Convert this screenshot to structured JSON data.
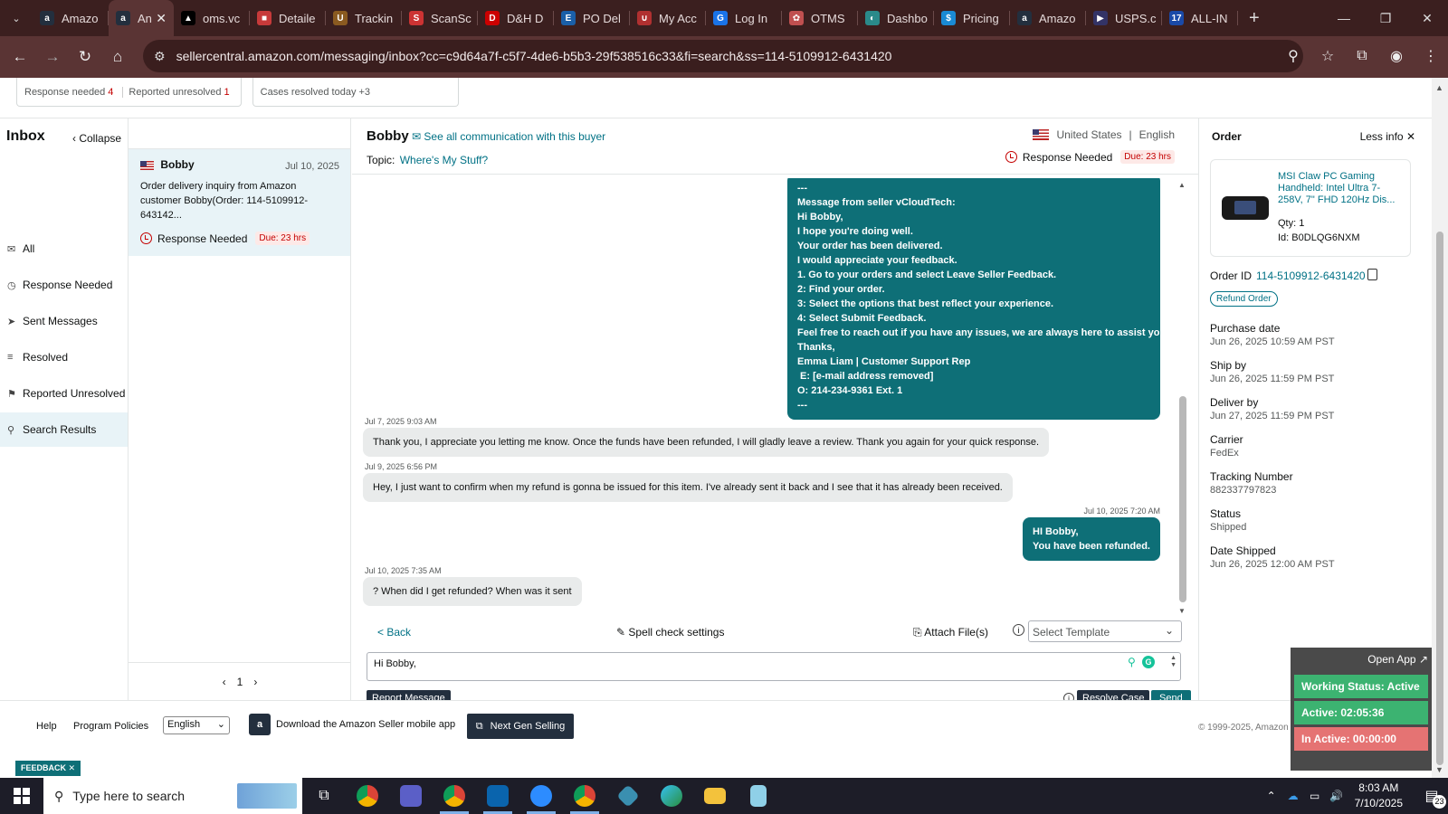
{
  "browser": {
    "tabs": [
      {
        "title": "Amazo",
        "color": "#232f3e",
        "glyph": "a"
      },
      {
        "title": "An",
        "color": "#232f3e",
        "glyph": "a",
        "active": true
      },
      {
        "title": "oms.vc",
        "color": "#000000",
        "glyph": "▲"
      },
      {
        "title": "Detaile",
        "color": "#c73a3a",
        "glyph": "■"
      },
      {
        "title": "Trackin",
        "color": "#8a5a20",
        "glyph": "U"
      },
      {
        "title": "ScanSc",
        "color": "#cc3333",
        "glyph": "S"
      },
      {
        "title": "D&H D",
        "color": "#cc0000",
        "glyph": "D"
      },
      {
        "title": "PO Del",
        "color": "#1a5fa8",
        "glyph": "E"
      },
      {
        "title": "My Acc",
        "color": "#b03030",
        "glyph": "∪"
      },
      {
        "title": "Log In",
        "color": "#1a73e8",
        "glyph": "G"
      },
      {
        "title": "OTMS",
        "color": "#c05050",
        "glyph": "✿"
      },
      {
        "title": "Dashbo",
        "color": "#2a8a8a",
        "glyph": "◐"
      },
      {
        "title": "Pricing",
        "color": "#1a8ad4",
        "glyph": "$"
      },
      {
        "title": "Amazo",
        "color": "#232f3e",
        "glyph": "a"
      },
      {
        "title": "USPS.c",
        "color": "#333366",
        "glyph": "▶"
      },
      {
        "title": "ALL-IN",
        "color": "#1a4aa8",
        "glyph": "17"
      }
    ],
    "url": "sellercentral.amazon.com/messaging/inbox?cc=c9d64a7f-c5f7-4de6-b5b3-29f538516c33&fi=search&ss=114-5109912-6431420"
  },
  "stats": {
    "response_needed_label": "Response needed",
    "response_needed_count": "4",
    "reported_unresolved_label": "Reported unresolved",
    "reported_unresolved_count": "1",
    "cases_resolved_label": "Cases resolved today",
    "cases_resolved_count": "+3"
  },
  "nav": {
    "title": "Inbox",
    "collapse": "Collapse",
    "items": [
      {
        "label": "All",
        "icon": "mail-icon"
      },
      {
        "label": "Response Needed",
        "icon": "clock-icon"
      },
      {
        "label": "Sent Messages",
        "icon": "send-icon"
      },
      {
        "label": "Resolved",
        "icon": "resolved-icon"
      },
      {
        "label": "Reported Unresolved",
        "icon": "reported-icon"
      },
      {
        "label": "Search Results",
        "icon": "search-icon",
        "selected": true
      }
    ]
  },
  "list": {
    "card": {
      "name": "Bobby",
      "date": "Jul 10, 2025",
      "text": "Order delivery inquiry from Amazon customer Bobby(Order: 114-5109912-643142...",
      "status": "Response Needed",
      "due": "Due: 23 hrs"
    },
    "page": "1"
  },
  "conversation": {
    "buyer": "Bobby",
    "see_all": "See all communication with this buyer",
    "topic_label": "Topic:",
    "topic": "Where's My Stuff?",
    "country": "United States",
    "language": "English",
    "response_needed": "Response Needed",
    "due": "Due: 23 hrs",
    "seller_msg": [
      "---",
      "Message from seller vCloudTech:",
      "Hi Bobby,",
      "I hope you're doing well.",
      "Your order has been delivered.",
      "I would appreciate your feedback.",
      "1. Go to your orders and select Leave Seller Feedback.",
      "2: Find your order.",
      "3: Select the options that best reflect your experience.",
      "4: Select Submit Feedback.",
      "Feel free to reach out if you have any issues, we are always here to assist you.",
      "Thanks,",
      "Emma Liam | Customer Support Rep",
      " E: [e-mail address removed]",
      "O: 214-234-9361 Ext. 1",
      "---"
    ],
    "msgs": [
      {
        "ts": "Jul 7, 2025 9:03 AM",
        "text": "Thank you, I appreciate you letting me know. Once the funds have been refunded, I will gladly leave a review. Thank you again for your quick response."
      },
      {
        "ts": "Jul 9, 2025 6:56 PM",
        "text": "Hey, I just want to confirm when my refund is gonna be issued for this item. I've already sent it back and I see that it has already been received."
      }
    ],
    "reply_ts": "Jul 10, 2025 7:20 AM",
    "reply_line1": "HI Bobby,",
    "reply_line2": "You have been refunded.",
    "last_ts": "Jul 10, 2025 7:35 AM",
    "last_text": "? When did I get refunded? When was it sent",
    "back": "< Back",
    "spell": "Spell check settings",
    "attach": "Attach File(s)",
    "template": "Select Template",
    "draft": "Hi Bobby,",
    "report": "Report Message",
    "resolve": "Resolve Case",
    "send": "Send"
  },
  "order": {
    "title": "Order",
    "less_info": "Less info",
    "product": "MSI Claw PC Gaming Handheld: Intel Ultra 7-258V, 7\" FHD 120Hz Dis...",
    "qty_label": "Qty:",
    "qty": "1",
    "id_label": "Id:",
    "id": "B0DLQG6NXM",
    "order_id_label": "Order ID",
    "order_id": "114-5109912-6431420",
    "refund": "Refund Order",
    "fields": [
      {
        "label": "Purchase date",
        "value": "Jun 26, 2025 10:59 AM PST"
      },
      {
        "label": "Ship by",
        "value": "Jun 26, 2025 11:59 PM PST"
      },
      {
        "label": "Deliver by",
        "value": "Jun 27, 2025 11:59 PM PST"
      },
      {
        "label": "Carrier",
        "value": "FedEx"
      },
      {
        "label": "Tracking Number",
        "value": "882337797823"
      },
      {
        "label": "Status",
        "value": "Shipped"
      },
      {
        "label": "Date Shipped",
        "value": "Jun 26, 2025 12:00 AM PST"
      }
    ]
  },
  "footer": {
    "help": "Help",
    "policies": "Program Policies",
    "language": "English",
    "app": "Download the Amazon Seller mobile app",
    "ngs": "Next Gen Selling",
    "copyright": "© 1999-2025, Amazon",
    "feedback": "FEEDBACK"
  },
  "widget": {
    "open": "Open App",
    "status": "Working Status: Active",
    "active": "Active: 02:05:36",
    "inactive": "In Active: 00:00:00",
    "status_color": "#3cb371",
    "active_color": "#3cb371",
    "inactive_color": "#e57373"
  },
  "taskbar": {
    "search": "Type here to search",
    "time": "8:03 AM",
    "date": "7/10/2025",
    "notif": "23"
  }
}
